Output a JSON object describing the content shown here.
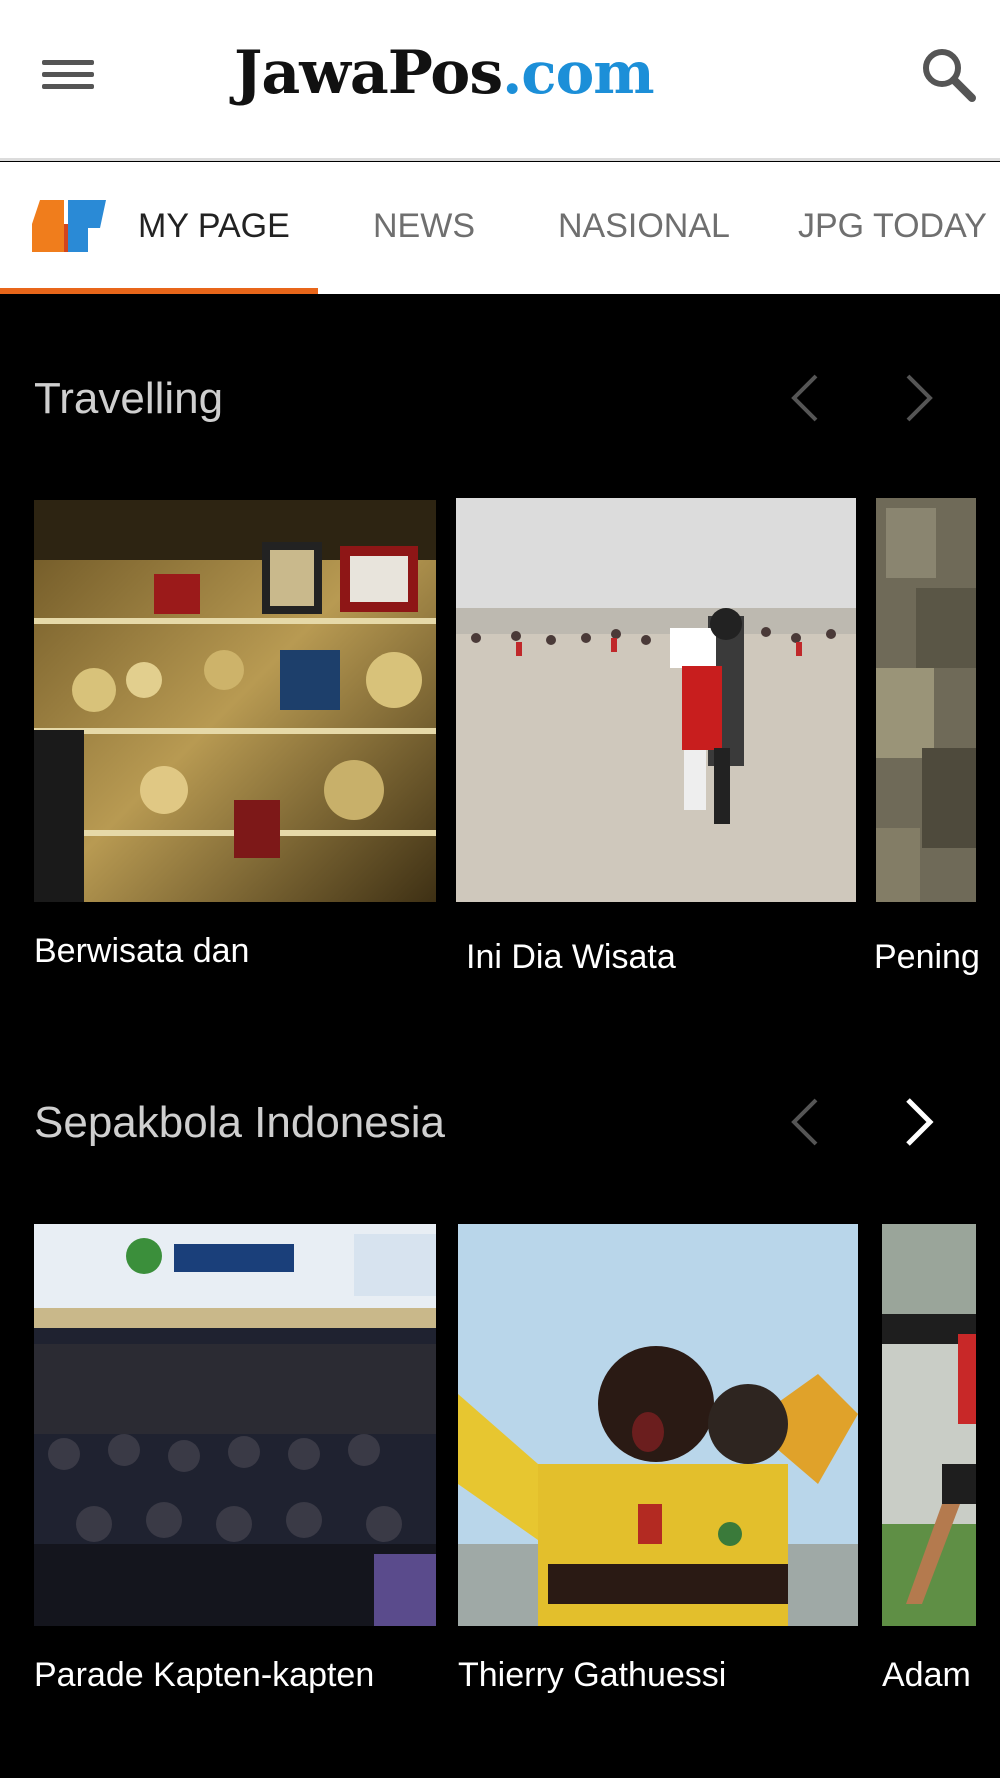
{
  "header": {
    "logo_main": "JawaPos",
    "logo_suffix": ".com",
    "menu_icon": "hamburger-menu-icon",
    "search_icon": "search-icon"
  },
  "tabs": [
    {
      "label": "MY PAGE",
      "active": true
    },
    {
      "label": "NEWS",
      "active": false
    },
    {
      "label": "NASIONAL",
      "active": false
    },
    {
      "label": "JPG TODAY",
      "active": false
    }
  ],
  "sections": [
    {
      "title": "Travelling",
      "cards": [
        {
          "title": "Berwisata dan"
        },
        {
          "title": "Ini Dia Wisata"
        },
        {
          "title": "Pening"
        }
      ]
    },
    {
      "title": "Sepakbola Indonesia",
      "cards": [
        {
          "title": "Parade Kapten-kapten"
        },
        {
          "title": "Thierry Gathuessi"
        },
        {
          "title": "Adam"
        }
      ]
    }
  ],
  "colors": {
    "accent": "#e8661a",
    "logo_blue": "#1c8fd8",
    "background": "#000000",
    "tab_active_text": "#222222",
    "tab_text": "#6f6f6f"
  }
}
